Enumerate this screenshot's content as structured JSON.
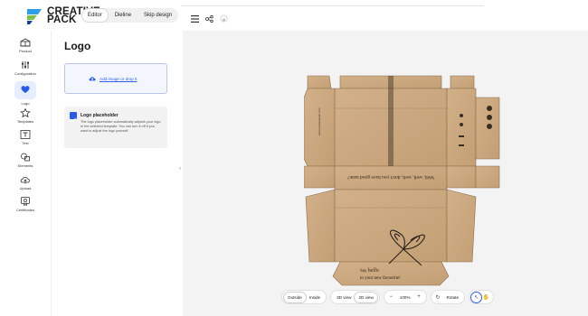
{
  "brand": {
    "line1": "CREATIVE",
    "line2": "PACK",
    "colors": [
      "#2f9ee6",
      "#7bc24a",
      "#1f3f9a"
    ]
  },
  "header": {
    "modes": [
      {
        "label": "Editor",
        "active": true
      },
      {
        "label": "Dieline",
        "active": false
      },
      {
        "label": "Skip design",
        "active": false
      }
    ],
    "icons": [
      "menu-icon",
      "share-icon",
      "loading-icon"
    ]
  },
  "rail": {
    "items": [
      {
        "label": "Product",
        "icon": "product-icon",
        "active": false
      },
      {
        "label": "Configuration",
        "icon": "configuration-icon",
        "active": false
      },
      {
        "label": "Logo",
        "icon": "heart-icon",
        "active": true
      },
      {
        "label": "Templates",
        "icon": "star-icon",
        "active": false
      },
      {
        "label": "Text",
        "icon": "text-icon",
        "active": false
      },
      {
        "label": "Elements",
        "icon": "elements-icon",
        "active": false
      },
      {
        "label": "Upload",
        "icon": "upload-icon",
        "active": false
      },
      {
        "label": "Certificates",
        "icon": "certificate-icon",
        "active": false
      }
    ]
  },
  "panel": {
    "title": "Logo",
    "upload_label": "Add image or drop it",
    "placeholder": {
      "title": "Logo placeholder",
      "checked": true,
      "description": "The logo placeholder automatically adjusts your logo to the selected template. You can turn it off if you want to adjust the logo yourself."
    }
  },
  "canvas": {
    "box_color": "#c9a57b",
    "box_text_top": "Well, well, well, don't you have good taste?",
    "box_text_bottom_1": "Say",
    "box_text_bottom_script": "hello",
    "box_text_bottom_2": "to your new favourite!"
  },
  "toolbar": {
    "outside": "Outside",
    "inside": "Inside",
    "view3d": "3D view",
    "view2d": "2D view",
    "zoom": "100%",
    "zoom_minus": "−",
    "zoom_plus": "+",
    "rotate": "Rotate",
    "accent": "#2a5be6"
  }
}
